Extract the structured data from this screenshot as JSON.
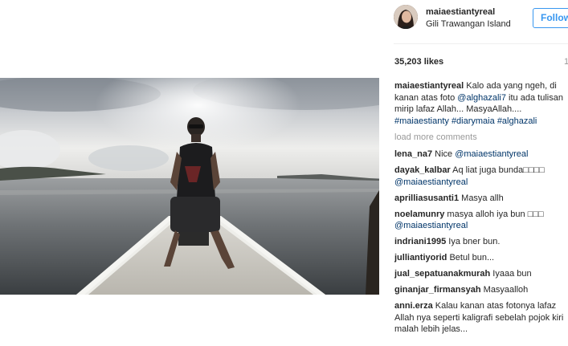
{
  "post": {
    "username": "maiaestiantyreal",
    "location": "Gili Trawangan Island",
    "follow_label": "Follow",
    "likes": "35,203 likes",
    "posted": "1"
  },
  "caption": {
    "user": "maiaestiantyreal",
    "text1": " Kalo ada yang ngeh, di kanan atas foto ",
    "mention": "@alghazali7",
    "text2": " itu ada tulisan mirip lafaz Allah... MasyaAllah.... ",
    "tag1": "#maiaestianty",
    "tag2": "#diarymaia",
    "tag3": "#alghazali"
  },
  "load_more": "load more comments",
  "comments": [
    {
      "user": "lena_na7",
      "text": " Nice ",
      "mention": "@maiaestiantyreal",
      "text_after": ""
    },
    {
      "user": "dayak_kalbar",
      "text": " Aq liat juga bunda□□□□ ",
      "mention": "@maiaestiantyreal",
      "text_after": ""
    },
    {
      "user": "aprilliasusanti1",
      "text": " Masya allh",
      "mention": "",
      "text_after": ""
    },
    {
      "user": "noelamunry",
      "text": " masya alloh iya bun □□□ ",
      "mention": "@maiaestiantyreal",
      "text_after": ""
    },
    {
      "user": "indriani1995",
      "text": " Iya bner bun.",
      "mention": "",
      "text_after": ""
    },
    {
      "user": "julliantiyorid",
      "text": " Betul bun...",
      "mention": "",
      "text_after": ""
    },
    {
      "user": "jual_sepatuanakmurah",
      "text": " Iyaaa bun",
      "mention": "",
      "text_after": ""
    },
    {
      "user": "ginanjar_firmansyah",
      "text": " Masyaalloh",
      "mention": "",
      "text_after": ""
    },
    {
      "user": "anni.erza",
      "text": " Kalau kanan atas fotonya lafaz Allah nya seperti kaligrafi sebelah pojok kiri malah lebih jelas...",
      "mention": "",
      "text_after": ""
    }
  ]
}
